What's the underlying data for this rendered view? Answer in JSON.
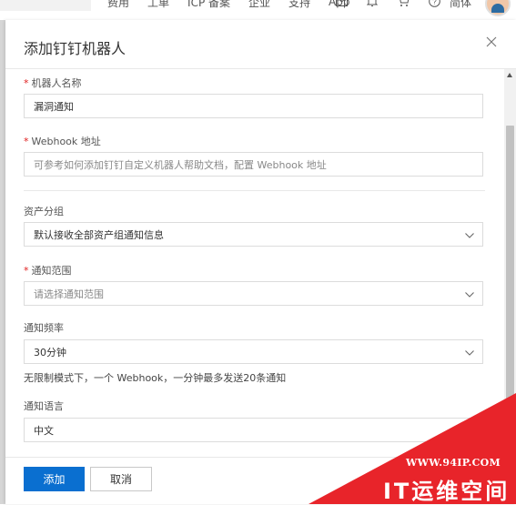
{
  "topbar": {
    "nav": [
      "费用",
      "工单",
      "ICP 备案",
      "企业",
      "支持",
      "App"
    ],
    "lang": "简体"
  },
  "dialog": {
    "title": "添加钉钉机器人",
    "fields": {
      "robot_name": {
        "label": "机器人名称",
        "required": true,
        "value": "漏洞通知"
      },
      "webhook": {
        "label": "Webhook 地址",
        "required": true,
        "placeholder": "可参考如何添加钉钉自定义机器人帮助文档，配置 Webhook 地址"
      },
      "asset_group": {
        "label": "资产分组",
        "required": false,
        "value": "默认接收全部资产组通知信息"
      },
      "notify_scope": {
        "label": "通知范围",
        "required": true,
        "placeholder": "请选择通知范围"
      },
      "notify_freq": {
        "label": "通知频率",
        "required": false,
        "value": "30分钟",
        "hint": "无限制模式下，一个 Webhook，一分钟最多发送20条通知"
      },
      "notify_lang": {
        "label": "通知语言",
        "required": false,
        "value": "中文"
      }
    },
    "buttons": {
      "add": "添加",
      "cancel": "取消"
    }
  },
  "watermark": {
    "url": "WWW.94IP.COM",
    "name": "IT运维空间"
  },
  "colors": {
    "primary": "#0a6fd0",
    "required": "#e02020",
    "watermark": "#e8242a"
  }
}
